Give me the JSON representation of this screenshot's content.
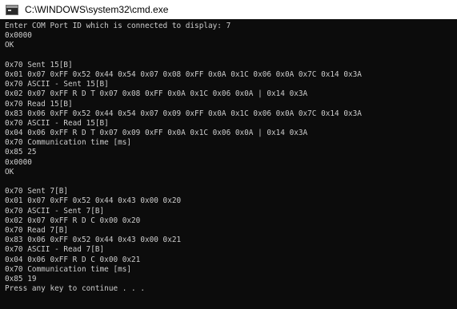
{
  "window": {
    "title": "C:\\WINDOWS\\system32\\cmd.exe",
    "icon": "cmd-icon"
  },
  "console": {
    "lines": [
      "Enter COM Port ID which is connected to display: 7",
      "0x0000",
      "OK",
      "",
      "0x70 Sent 15[B]",
      "0x01 0x07 0xFF 0x52 0x44 0x54 0x07 0x08 0xFF 0x0A 0x1C 0x06 0x0A 0x7C 0x14 0x3A",
      "0x70 ASCII - Sent 15[B]",
      "0x02 0x07 0xFF R D T 0x07 0x08 0xFF 0x0A 0x1C 0x06 0x0A | 0x14 0x3A",
      "0x70 Read 15[B]",
      "0x83 0x06 0xFF 0x52 0x44 0x54 0x07 0x09 0xFF 0x0A 0x1C 0x06 0x0A 0x7C 0x14 0x3A",
      "0x70 ASCII - Read 15[B]",
      "0x04 0x06 0xFF R D T 0x07 0x09 0xFF 0x0A 0x1C 0x06 0x0A | 0x14 0x3A",
      "0x70 Communication time [ms]",
      "0x85 25",
      "0x0000",
      "OK",
      "",
      "0x70 Sent 7[B]",
      "0x01 0x07 0xFF 0x52 0x44 0x43 0x00 0x20",
      "0x70 ASCII - Sent 7[B]",
      "0x02 0x07 0xFF R D C 0x00 0x20",
      "0x70 Read 7[B]",
      "0x83 0x06 0xFF 0x52 0x44 0x43 0x00 0x21",
      "0x70 ASCII - Read 7[B]",
      "0x04 0x06 0xFF R D C 0x00 0x21",
      "0x70 Communication time [ms]",
      "0x85 19",
      "Press any key to continue . . ."
    ]
  }
}
